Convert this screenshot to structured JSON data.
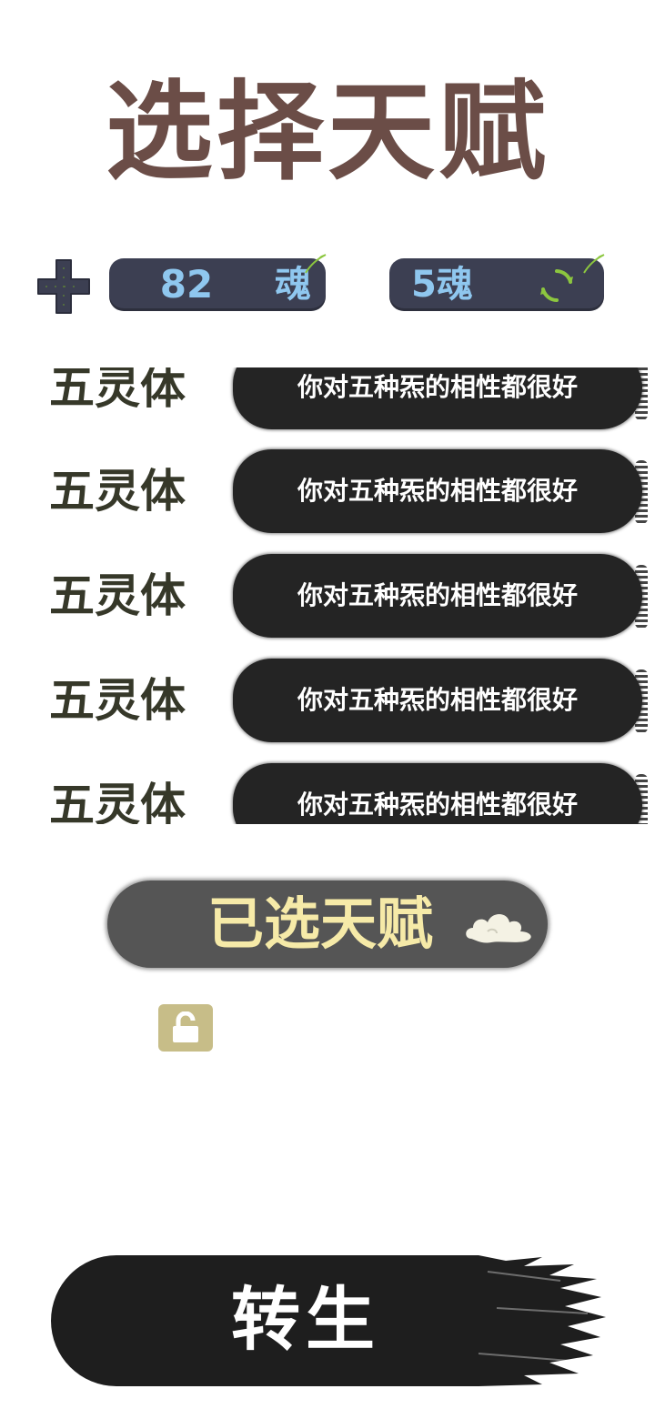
{
  "header": {
    "title": "选择天赋"
  },
  "resources": {
    "soul_amount": "82",
    "soul_unit": "魂",
    "reroll_cost": "5魂"
  },
  "talents": [
    {
      "name": "五灵体",
      "description": "你对五种炁的相性都很好"
    },
    {
      "name": "五灵体",
      "description": "你对五种炁的相性都很好"
    },
    {
      "name": "五灵体",
      "description": "你对五种炁的相性都很好"
    },
    {
      "name": "五灵体",
      "description": "你对五种炁的相性都很好"
    },
    {
      "name": "五灵体",
      "description": "你对五种炁的相性都很好"
    }
  ],
  "selected": {
    "label": "已选天赋"
  },
  "actions": {
    "rebirth_label": "转生"
  },
  "colors": {
    "title": "#6b4d47",
    "pill_bg": "#3c3f52",
    "pill_text": "#8fc7ef",
    "leaf_green": "#8cc63f",
    "banner_text": "#f6eaa8",
    "lock_slot": "#c7bd88"
  },
  "icons": {
    "add": "plus-icon",
    "leaf": "leaf-icon",
    "reroll": "refresh-icon",
    "cloud": "cloud-icon",
    "lock": "unlock-icon"
  }
}
